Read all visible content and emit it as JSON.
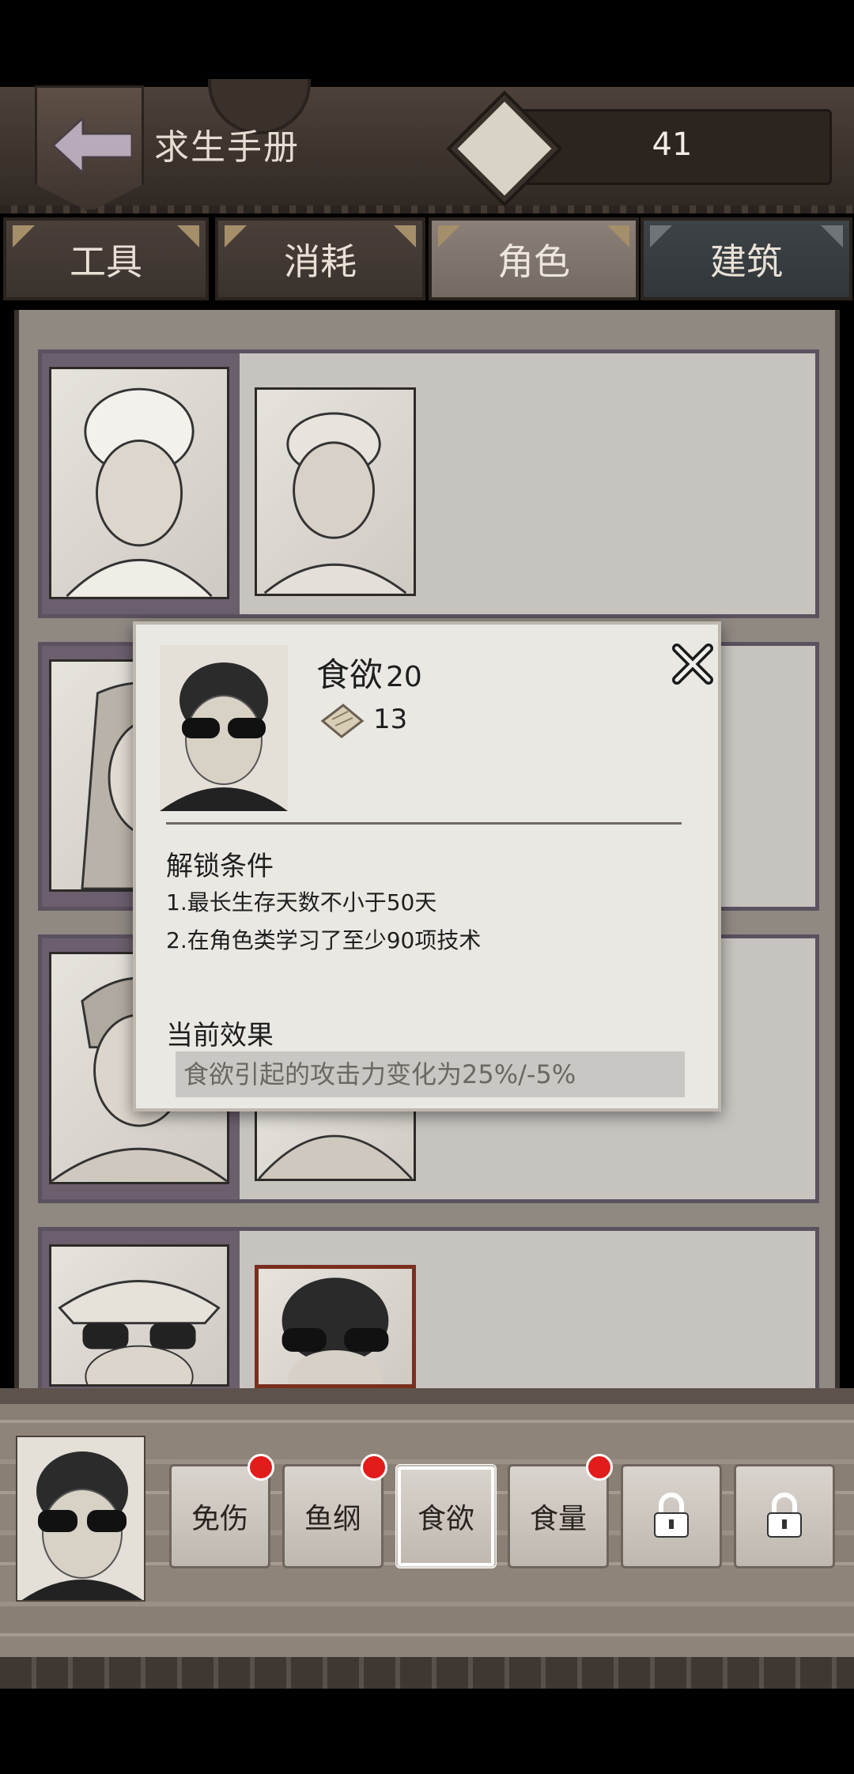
{
  "header": {
    "title": "求生手册",
    "currency_value": "41",
    "currency_icon": "paper-scroll-icon",
    "back_icon": "back-arrow-icon"
  },
  "tabs": [
    {
      "label": "工具",
      "active": false
    },
    {
      "label": "消耗",
      "active": false
    },
    {
      "label": "角色",
      "active": true
    },
    {
      "label": "建筑",
      "active": false
    }
  ],
  "popup": {
    "name": "食欲",
    "level": "20",
    "cost": "13",
    "unlock_title": "解锁条件",
    "unlock_lines": [
      "1.最长生存天数不小于50天",
      "2.在角色类学习了至少90项技术"
    ],
    "effect_title": "当前效果",
    "effect_text": "食欲引起的攻击力变化为25%/-5%",
    "close_icon": "close-x-icon"
  },
  "skills": [
    {
      "label": "免伤",
      "badge": true,
      "locked": false,
      "selected": false
    },
    {
      "label": "鱼纲",
      "badge": true,
      "locked": false,
      "selected": false
    },
    {
      "label": "食欲",
      "badge": false,
      "locked": false,
      "selected": true
    },
    {
      "label": "食量",
      "badge": true,
      "locked": false,
      "selected": false
    },
    {
      "label": "",
      "badge": false,
      "locked": true,
      "selected": false
    },
    {
      "label": "",
      "badge": false,
      "locked": true,
      "selected": false
    }
  ],
  "colors": {
    "badge": "#e21b1b",
    "active_tab": "#7d736b",
    "paper": "#eae8e3"
  }
}
